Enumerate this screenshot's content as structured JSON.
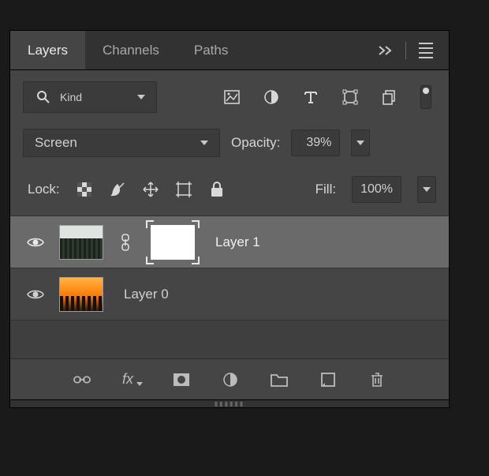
{
  "tabs": {
    "layers": "Layers",
    "channels": "Channels",
    "paths": "Paths"
  },
  "filter": {
    "label": "Kind"
  },
  "blend": {
    "mode": "Screen"
  },
  "opacity": {
    "label": "Opacity:",
    "value": "39%"
  },
  "fill": {
    "label": "Fill:",
    "value": "100%"
  },
  "lock": {
    "label": "Lock:"
  },
  "layers": [
    {
      "name": "Layer 1",
      "selected": true,
      "has_mask": true,
      "thumb": "forest"
    },
    {
      "name": "Layer 0",
      "selected": false,
      "has_mask": false,
      "thumb": "city"
    }
  ],
  "bottom": {
    "fx": "fx"
  }
}
